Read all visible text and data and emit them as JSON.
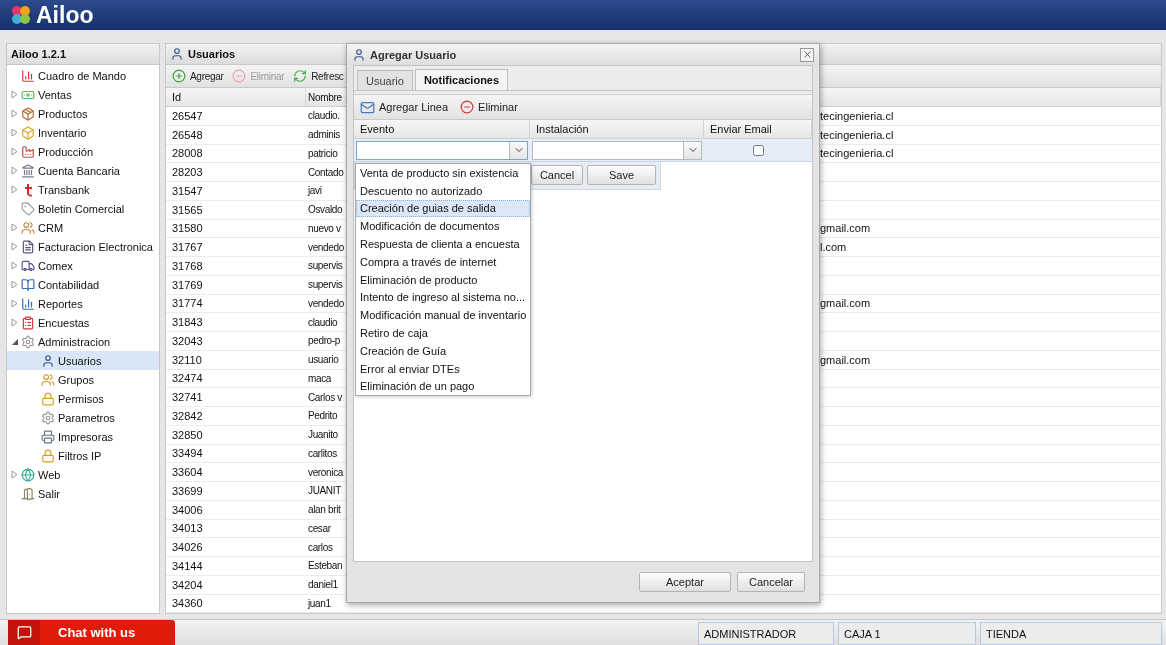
{
  "header": {
    "logo": "Ailoo"
  },
  "sidebar": {
    "title": "Ailoo 1.2.1",
    "items": [
      {
        "label": "Cuadro de Mando",
        "kind": "leaf",
        "selected": false
      },
      {
        "label": "Ventas",
        "kind": "group",
        "expanded": false,
        "selected": false
      },
      {
        "label": "Productos",
        "kind": "group",
        "expanded": false,
        "selected": false
      },
      {
        "label": "Inventario",
        "kind": "group",
        "expanded": false,
        "selected": false
      },
      {
        "label": "Producción",
        "kind": "group",
        "expanded": false,
        "selected": false
      },
      {
        "label": "Cuenta Bancaria",
        "kind": "group",
        "expanded": false,
        "selected": false
      },
      {
        "label": "Transbank",
        "kind": "group",
        "expanded": false,
        "selected": false
      },
      {
        "label": "Boletin Comercial",
        "kind": "leaf",
        "selected": false
      },
      {
        "label": "CRM",
        "kind": "group",
        "expanded": false,
        "selected": false
      },
      {
        "label": "Facturacion Electronica",
        "kind": "group",
        "expanded": false,
        "selected": false
      },
      {
        "label": "Comex",
        "kind": "group",
        "expanded": false,
        "selected": false
      },
      {
        "label": "Contabilidad",
        "kind": "group",
        "expanded": false,
        "selected": false
      },
      {
        "label": "Reportes",
        "kind": "group",
        "expanded": false,
        "selected": false
      },
      {
        "label": "Encuestas",
        "kind": "group",
        "expanded": false,
        "selected": false
      },
      {
        "label": "Administracion",
        "kind": "group",
        "expanded": true,
        "selected": false,
        "children": [
          {
            "label": "Usuarios",
            "selected": true
          },
          {
            "label": "Grupos",
            "selected": false
          },
          {
            "label": "Permisos",
            "selected": false
          },
          {
            "label": "Parametros",
            "selected": false
          },
          {
            "label": "Impresoras",
            "selected": false
          },
          {
            "label": "Filtros IP",
            "selected": false
          }
        ]
      },
      {
        "label": "Web",
        "kind": "group",
        "expanded": false,
        "selected": false
      },
      {
        "label": "Salir",
        "kind": "leaf",
        "selected": false
      }
    ]
  },
  "main": {
    "title": "Usuarios",
    "toolbar": [
      {
        "label": "Agregar",
        "disabled": false
      },
      {
        "label": "Eliminar",
        "disabled": true
      },
      {
        "label": "Refresc",
        "disabled": false
      }
    ],
    "table": {
      "columns": [
        "Id",
        "Nombre"
      ],
      "rows": [
        {
          "id": "26547",
          "name": "claudio.",
          "email": "tecingenieria.cl"
        },
        {
          "id": "26548",
          "name": "adminis",
          "email": "tecingenieria.cl"
        },
        {
          "id": "28008",
          "name": "patricio",
          "email": "tecingenieria.cl"
        },
        {
          "id": "28203",
          "name": "Contado"
        },
        {
          "id": "31547",
          "name": "javi"
        },
        {
          "id": "31565",
          "name": "Osvaldo"
        },
        {
          "id": "31580",
          "name": "nuevo v",
          "email": "gmail.com"
        },
        {
          "id": "31767",
          "name": "vendedo",
          "email": "l.com"
        },
        {
          "id": "31768",
          "name": "supervis"
        },
        {
          "id": "31769",
          "name": "supervis"
        },
        {
          "id": "31774",
          "name": "vendedo",
          "email": "gmail.com"
        },
        {
          "id": "31843",
          "name": "claudio"
        },
        {
          "id": "32043",
          "name": "pedro-p"
        },
        {
          "id": "32110",
          "name": "usuario",
          "email": "gmail.com"
        },
        {
          "id": "32474",
          "name": "maca"
        },
        {
          "id": "32741",
          "name": "Carlos v"
        },
        {
          "id": "32842",
          "name": "Pedrito"
        },
        {
          "id": "32850",
          "name": "Juanito"
        },
        {
          "id": "33494",
          "name": "carlitos"
        },
        {
          "id": "33604",
          "name": "veronica"
        },
        {
          "id": "33699",
          "name": "JUANIT"
        },
        {
          "id": "34006",
          "name": "alan brit"
        },
        {
          "id": "34013",
          "name": "cesar"
        },
        {
          "id": "34026",
          "name": "carlos"
        },
        {
          "id": "34144",
          "name": "Esteban"
        },
        {
          "id": "34204",
          "name": "daniel1"
        },
        {
          "id": "34360",
          "name": "juan1"
        }
      ]
    }
  },
  "dialog": {
    "title": "Agregar Usuario",
    "tabs": [
      {
        "label": "Usuario",
        "selected": false
      },
      {
        "label": "Notificaciones",
        "selected": true
      }
    ],
    "toolbar": [
      "Agregar Linea",
      "Eliminar"
    ],
    "grid": {
      "columns": [
        "Evento",
        "Instalación",
        "Enviar Email"
      ],
      "send_email_checked": false
    },
    "row_buttons": [
      "Cancel",
      "Save"
    ],
    "dropdown": [
      {
        "label": "Venta de producto sin existencia",
        "selected": false
      },
      {
        "label": "Descuento no autorizado",
        "selected": false
      },
      {
        "label": "Creación de guias de salida",
        "selected": true
      },
      {
        "label": "Modificación de documentos",
        "selected": false
      },
      {
        "label": "Respuesta de clienta a encuesta",
        "selected": false
      },
      {
        "label": "Compra a través de internet",
        "selected": false
      },
      {
        "label": "Eliminación de producto",
        "selected": false
      },
      {
        "label": "Intento de ingreso al sistema no...",
        "selected": false
      },
      {
        "label": "Modificación manual de inventario",
        "selected": false
      },
      {
        "label": "Retiro de caja",
        "selected": false
      },
      {
        "label": "Creación de Guía",
        "selected": false
      },
      {
        "label": "Error al enviar DTEs",
        "selected": false
      },
      {
        "label": "Eliminación de un pago",
        "selected": false
      }
    ],
    "buttons": [
      "Aceptar",
      "Cancelar"
    ]
  },
  "status_bar": {
    "chat": "Chat with us",
    "fields": [
      "ADMINISTRADOR",
      "CAJA 1",
      "TIENDA"
    ]
  }
}
